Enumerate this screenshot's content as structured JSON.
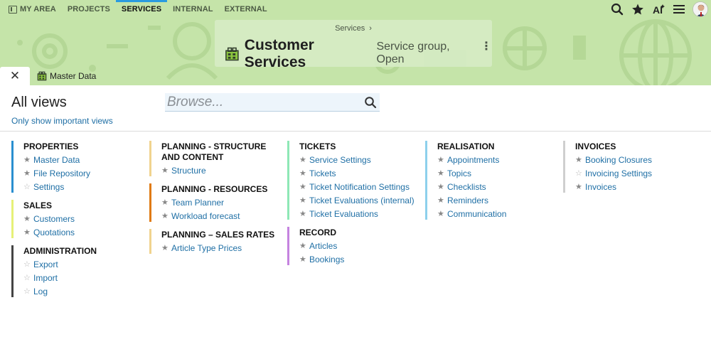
{
  "nav": {
    "items": [
      {
        "label": "MY AREA",
        "active": false
      },
      {
        "label": "PROJECTS",
        "active": false
      },
      {
        "label": "SERVICES",
        "active": true
      },
      {
        "label": "INTERNAL",
        "active": false
      },
      {
        "label": "EXTERNAL",
        "active": false
      }
    ]
  },
  "header_actions": [
    "search-icon",
    "star-icon",
    "ai-icon",
    "menu-icon",
    "avatar"
  ],
  "breadcrumb": {
    "label": "Services",
    "separator": "›"
  },
  "title": {
    "main": "Customer Services",
    "subtitle": "Service group, Open",
    "kebab": "⋮"
  },
  "tabs": {
    "close": "✕",
    "master_data": "Master Data"
  },
  "main": {
    "heading": "All views",
    "important_link": "Only show important views",
    "browse_placeholder": "Browse..."
  },
  "colors": {
    "header_bg": "#c5e4a9",
    "link": "#1f6fa5",
    "active_nav_bar": "#2a9be0"
  },
  "columns": [
    {
      "groups": [
        {
          "title": "PROPERTIES",
          "color": "#2a8fd0",
          "items": [
            {
              "label": "Master Data",
              "starred": true
            },
            {
              "label": "File Repository",
              "starred": true
            },
            {
              "label": "Settings",
              "starred": false
            }
          ]
        },
        {
          "title": "SALES",
          "color": "#e6f077",
          "items": [
            {
              "label": "Customers",
              "starred": true
            },
            {
              "label": "Quotations",
              "starred": true
            }
          ]
        },
        {
          "title": "ADMINISTRATION",
          "color": "#444444",
          "items": [
            {
              "label": "Export",
              "starred": false
            },
            {
              "label": "Import",
              "starred": false
            },
            {
              "label": "Log",
              "starred": false
            }
          ]
        }
      ]
    },
    {
      "groups": [
        {
          "title": "PLANNING - STRUCTURE AND CONTENT",
          "color": "#f0d38e",
          "items": [
            {
              "label": "Structure",
              "starred": true
            }
          ]
        },
        {
          "title": "PLANNING - RESOURCES",
          "color": "#e07a12",
          "items": [
            {
              "label": "Team Planner",
              "starred": true
            },
            {
              "label": "Workload forecast",
              "starred": true
            }
          ]
        },
        {
          "title": "PLANNING – SALES RATES",
          "color": "#f0d38e",
          "items": [
            {
              "label": "Article Type Prices",
              "starred": true
            }
          ]
        }
      ]
    },
    {
      "groups": [
        {
          "title": "TICKETS",
          "color": "#8ee8b6",
          "items": [
            {
              "label": "Service Settings",
              "starred": true
            },
            {
              "label": "Tickets",
              "starred": true
            },
            {
              "label": "Ticket Notification Settings",
              "starred": true
            },
            {
              "label": "Ticket Evaluations (internal)",
              "starred": true
            },
            {
              "label": "Ticket Evaluations",
              "starred": true
            }
          ]
        },
        {
          "title": "RECORD",
          "color": "#c583e0",
          "items": [
            {
              "label": "Articles",
              "starred": true
            },
            {
              "label": "Bookings",
              "starred": true
            }
          ]
        }
      ]
    },
    {
      "groups": [
        {
          "title": "REALISATION",
          "color": "#8dd0ec",
          "items": [
            {
              "label": "Appointments",
              "starred": true
            },
            {
              "label": "Topics",
              "starred": true
            },
            {
              "label": "Checklists",
              "starred": true
            },
            {
              "label": "Reminders",
              "starred": true
            },
            {
              "label": "Communication",
              "starred": true
            }
          ]
        }
      ]
    },
    {
      "groups": [
        {
          "title": "INVOICES",
          "color": "#cfcfcf",
          "items": [
            {
              "label": "Booking Closures",
              "starred": true
            },
            {
              "label": "Invoicing Settings",
              "starred": false
            },
            {
              "label": "Invoices",
              "starred": true
            }
          ]
        }
      ]
    }
  ]
}
